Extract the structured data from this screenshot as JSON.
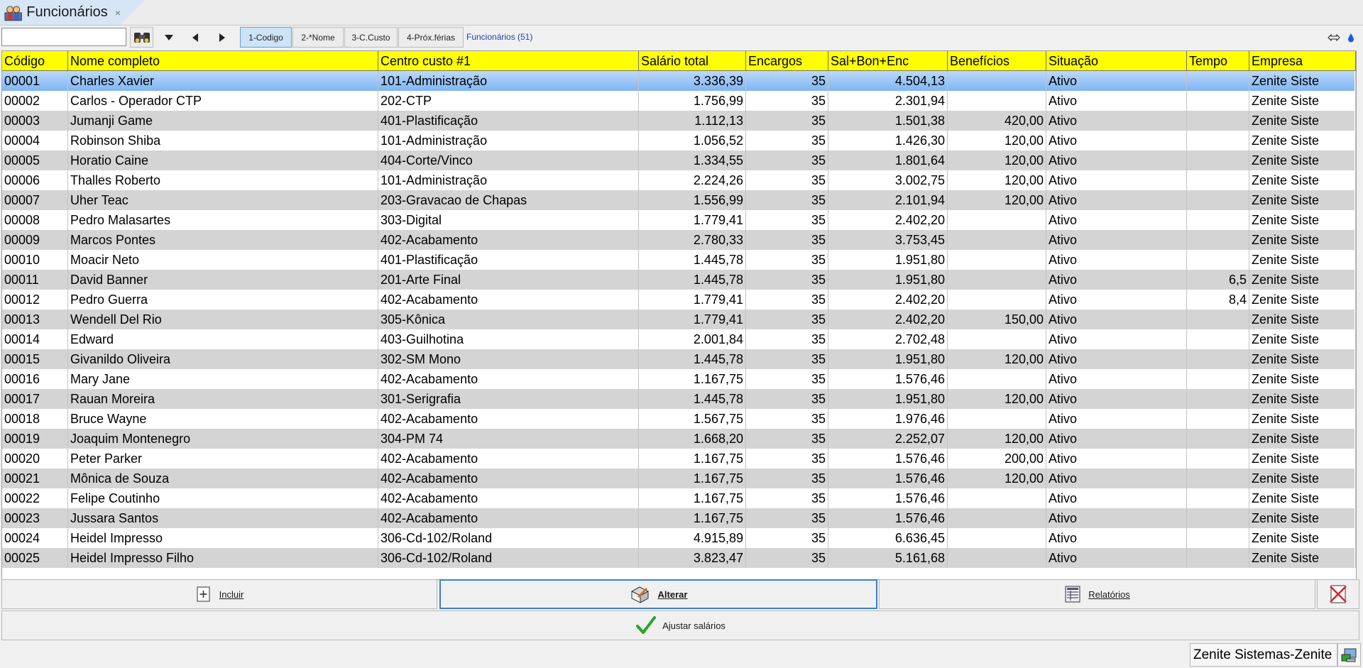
{
  "window": {
    "tab_title": "Funcionários",
    "tab_close": "×"
  },
  "toolbar": {
    "search_value": "",
    "sort_tabs": [
      "1-Codigo",
      "2-*Nome",
      "3-C.Custo",
      "4-Próx.férias"
    ],
    "active_sort": "1-Codigo",
    "list_title": "Funcionários (51)"
  },
  "columns": [
    "Código",
    "Nome completo",
    "Centro custo #1",
    "Salário total",
    "Encargos",
    "Sal+Bon+Enc",
    "Benefícios",
    "Situação",
    "Tempo",
    "Empresa"
  ],
  "rows": [
    [
      "00001",
      "Charles Xavier",
      "101-Administração",
      "3.336,39",
      "35",
      "4.504,13",
      "",
      "Ativo",
      "",
      "Zenite Siste"
    ],
    [
      "00002",
      "Carlos - Operador CTP",
      "202-CTP",
      "1.756,99",
      "35",
      "2.301,94",
      "",
      "Ativo",
      "",
      "Zenite Siste"
    ],
    [
      "00003",
      "Jumanji Game",
      "401-Plastificação",
      "1.112,13",
      "35",
      "1.501,38",
      "420,00",
      "Ativo",
      "",
      "Zenite Siste"
    ],
    [
      "00004",
      "Robinson Shiba",
      "101-Administração",
      "1.056,52",
      "35",
      "1.426,30",
      "120,00",
      "Ativo",
      "",
      "Zenite Siste"
    ],
    [
      "00005",
      "Horatio Caine",
      "404-Corte/Vinco",
      "1.334,55",
      "35",
      "1.801,64",
      "120,00",
      "Ativo",
      "",
      "Zenite Siste"
    ],
    [
      "00006",
      "Thalles Roberto",
      "101-Administração",
      "2.224,26",
      "35",
      "3.002,75",
      "120,00",
      "Ativo",
      "",
      "Zenite Siste"
    ],
    [
      "00007",
      "Uher Teac",
      "203-Gravacao de Chapas",
      "1.556,99",
      "35",
      "2.101,94",
      "120,00",
      "Ativo",
      "",
      "Zenite Siste"
    ],
    [
      "00008",
      "Pedro Malasartes",
      "303-Digital",
      "1.779,41",
      "35",
      "2.402,20",
      "",
      "Ativo",
      "",
      "Zenite Siste"
    ],
    [
      "00009",
      "Marcos Pontes",
      "402-Acabamento",
      "2.780,33",
      "35",
      "3.753,45",
      "",
      "Ativo",
      "",
      "Zenite Siste"
    ],
    [
      "00010",
      "Moacir Neto",
      "401-Plastificação",
      "1.445,78",
      "35",
      "1.951,80",
      "",
      "Ativo",
      "",
      "Zenite Siste"
    ],
    [
      "00011",
      "David Banner",
      "201-Arte Final",
      "1.445,78",
      "35",
      "1.951,80",
      "",
      "Ativo",
      "6,5",
      "Zenite Siste"
    ],
    [
      "00012",
      "Pedro Guerra",
      "402-Acabamento",
      "1.779,41",
      "35",
      "2.402,20",
      "",
      "Ativo",
      "8,4",
      "Zenite Siste"
    ],
    [
      "00013",
      "Wendell Del Rio",
      "305-Kônica",
      "1.779,41",
      "35",
      "2.402,20",
      "150,00",
      "Ativo",
      "",
      "Zenite Siste"
    ],
    [
      "00014",
      "Edward",
      "403-Guilhotina",
      "2.001,84",
      "35",
      "2.702,48",
      "",
      "Ativo",
      "",
      "Zenite Siste"
    ],
    [
      "00015",
      "Givanildo Oliveira",
      "302-SM Mono",
      "1.445,78",
      "35",
      "1.951,80",
      "120,00",
      "Ativo",
      "",
      "Zenite Siste"
    ],
    [
      "00016",
      "Mary Jane",
      "402-Acabamento",
      "1.167,75",
      "35",
      "1.576,46",
      "",
      "Ativo",
      "",
      "Zenite Siste"
    ],
    [
      "00017",
      "Rauan Moreira",
      "301-Serigrafia",
      "1.445,78",
      "35",
      "1.951,80",
      "120,00",
      "Ativo",
      "",
      "Zenite Siste"
    ],
    [
      "00018",
      "Bruce Wayne",
      "402-Acabamento",
      "1.567,75",
      "35",
      "1.976,46",
      "",
      "Ativo",
      "",
      "Zenite Siste"
    ],
    [
      "00019",
      "Joaquim Montenegro",
      "304-PM 74",
      "1.668,20",
      "35",
      "2.252,07",
      "120,00",
      "Ativo",
      "",
      "Zenite Siste"
    ],
    [
      "00020",
      "Peter Parker",
      "402-Acabamento",
      "1.167,75",
      "35",
      "1.576,46",
      "200,00",
      "Ativo",
      "",
      "Zenite Siste"
    ],
    [
      "00021",
      "Mônica de Souza",
      "402-Acabamento",
      "1.167,75",
      "35",
      "1.576,46",
      "120,00",
      "Ativo",
      "",
      "Zenite Siste"
    ],
    [
      "00022",
      "Felipe Coutinho",
      "402-Acabamento",
      "1.167,75",
      "35",
      "1.576,46",
      "",
      "Ativo",
      "",
      "Zenite Siste"
    ],
    [
      "00023",
      "Jussara Santos",
      "402-Acabamento",
      "1.167,75",
      "35",
      "1.576,46",
      "",
      "Ativo",
      "",
      "Zenite Siste"
    ],
    [
      "00024",
      "Heidel Impresso",
      "306-Cd-102/Roland",
      "4.915,89",
      "35",
      "6.636,45",
      "",
      "Ativo",
      "",
      "Zenite Siste"
    ],
    [
      "00025",
      "Heidel Impresso Filho",
      "306-Cd-102/Roland",
      "3.823,47",
      "35",
      "5.161,68",
      "",
      "Ativo",
      "",
      "Zenite Siste"
    ]
  ],
  "selected_row": 0,
  "actions": {
    "incluir": "Incluir",
    "alterar": "Alterar",
    "relatorios": "Relatórios",
    "ajustar": "Ajustar salários"
  },
  "status": {
    "company": "Zenite Sistemas-Zenite"
  },
  "icons": {
    "tab": "people-icon",
    "find": "binoculars-icon",
    "incluir": "add-document-icon",
    "alterar": "edit-icon",
    "relatorios": "report-icon",
    "close": "close-red-icon",
    "ajustar": "check-icon",
    "status": "computer-icon"
  },
  "colors": {
    "header_bg": "#ffff00",
    "selected_row": "#7fb5f3",
    "alt_row": "#d4d4d4",
    "check": "#2aa52a"
  }
}
